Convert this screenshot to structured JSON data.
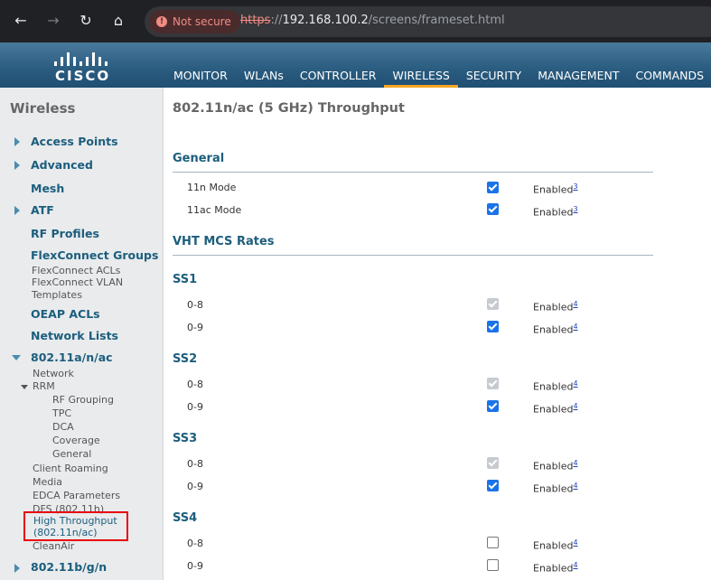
{
  "browser": {
    "security_label": "Not secure",
    "url_scheme": "https",
    "url_sep": "://",
    "url_host": "192.168.100.2",
    "url_path": "/screens/frameset.html"
  },
  "header": {
    "logo_text": "CISCO",
    "menu": [
      {
        "label": "MONITOR"
      },
      {
        "label": "WLANs"
      },
      {
        "label": "CONTROLLER"
      },
      {
        "label": "WIRELESS"
      },
      {
        "label": "SECURITY"
      },
      {
        "label": "MANAGEMENT"
      },
      {
        "label": "COMMANDS"
      }
    ],
    "active": "WIRELESS"
  },
  "sidebar": {
    "title": "Wireless",
    "access_points": "Access Points",
    "advanced": "Advanced",
    "mesh": "Mesh",
    "atf": "ATF",
    "rf_profiles": "RF Profiles",
    "flexconnect_groups": "FlexConnect Groups",
    "flexconnect_acls": "FlexConnect ACLs",
    "flexconnect_vlan_1": "FlexConnect VLAN",
    "flexconnect_vlan_2": "Templates",
    "oeap_acls": "OEAP ACLs",
    "network_lists": "Network Lists",
    "band_a": "802.11a/n/ac",
    "network": "Network",
    "rrm": "RRM",
    "rf_grouping": "RF Grouping",
    "tpc": "TPC",
    "dca": "DCA",
    "coverage": "Coverage",
    "general": "General",
    "client_roaming": "Client Roaming",
    "media": "Media",
    "edca": "EDCA Parameters",
    "dfs": "DFS (802.11h)",
    "high_throughput_1": "High Throughput",
    "high_throughput_2": "(802.11n/ac)",
    "cleanair": "CleanAir",
    "band_b": "802.11b/g/n"
  },
  "main": {
    "title": "802.11n/ac (5 GHz) Throughput",
    "general_heading": "General",
    "mode_11n": "11n Mode",
    "mode_11ac": "11ac Mode",
    "vht_heading": "VHT MCS Rates",
    "enabled_label": "Enabled",
    "footnote_3": "3",
    "footnote_4": "4",
    "ss1": "SS1",
    "ss2": "SS2",
    "ss3": "SS3",
    "ss4": "SS4",
    "rate_08": "0-8",
    "rate_09": "0-9"
  }
}
